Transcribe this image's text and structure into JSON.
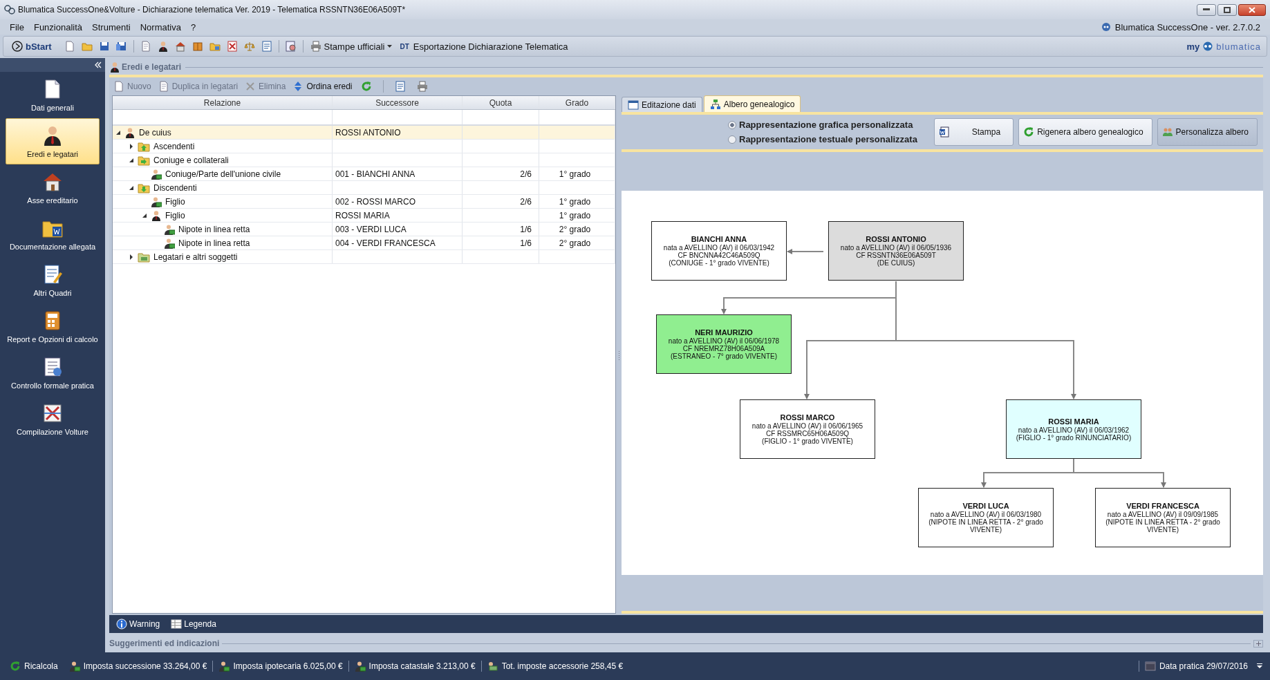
{
  "window": {
    "title": "Blumatica SuccessOne&Volture - Dichiarazione telematica Ver. 2019 - Telematica RSSNTN36E06A509T*",
    "product": "Blumatica SuccessOne - ver. 2.7.0.2"
  },
  "menu": [
    "File",
    "Funzionalità",
    "Strumenti",
    "Normativa",
    "?"
  ],
  "toolbar": {
    "start": "bStart",
    "print": "Stampe ufficiali",
    "export_badge": "DT",
    "export": "Esportazione Dichiarazione Telematica",
    "brand_prefix": "my",
    "brand": "blumatica"
  },
  "sidebar": {
    "items": [
      {
        "label": "Dati generali",
        "selected": false
      },
      {
        "label": "Eredi e legatari",
        "selected": true
      },
      {
        "label": "Asse ereditario",
        "selected": false
      },
      {
        "label": "Documentazione allegata",
        "selected": false
      },
      {
        "label": "Altri Quadri",
        "selected": false
      },
      {
        "label": "Report e Opzioni di calcolo",
        "selected": false
      },
      {
        "label": "Controllo formale pratica",
        "selected": false
      },
      {
        "label": "Compilazione Volture",
        "selected": false
      }
    ]
  },
  "panel": {
    "title": "Eredi e legatari",
    "actions": [
      {
        "label": "Nuovo",
        "disabled": true
      },
      {
        "label": "Duplica in legatari",
        "disabled": true
      },
      {
        "label": "Elimina",
        "disabled": true
      },
      {
        "label": "Ordina eredi",
        "disabled": false
      }
    ]
  },
  "grid": {
    "columns": [
      "Relazione",
      "Successore",
      "Quota",
      "Grado"
    ],
    "rows": [
      {
        "relation": "De cuius",
        "successor": "ROSSI ANTONIO",
        "kind": "person",
        "expanded": true,
        "selected": true,
        "children": [
          {
            "relation": "Ascendenti",
            "kind": "ascendants",
            "expanded": false,
            "selected": false
          },
          {
            "relation": "Coniuge e collaterali",
            "kind": "collaterals",
            "expanded": true,
            "selected": false,
            "children": [
              {
                "relation": "Coniuge/Parte dell'unione civile",
                "successor": "001 - BIANCHI ANNA",
                "share": "2/6",
                "degree": "1° grado",
                "kind": "heir",
                "selected": false
              }
            ]
          },
          {
            "relation": "Discendenti",
            "kind": "descendants",
            "expanded": true,
            "selected": false,
            "children": [
              {
                "relation": "Figlio",
                "successor": "002 - ROSSI MARCO",
                "share": "2/6",
                "degree": "1° grado",
                "kind": "heir",
                "selected": false
              },
              {
                "relation": "Figlio",
                "successor": "ROSSI MARIA",
                "degree": "1° grado",
                "kind": "person",
                "expanded": true,
                "selected": false,
                "children": [
                  {
                    "relation": "Nipote in linea retta",
                    "successor": "003 - VERDI LUCA",
                    "share": "1/6",
                    "degree": "2° grado",
                    "kind": "heir",
                    "selected": false
                  },
                  {
                    "relation": "Nipote in linea retta",
                    "successor": "004 - VERDI FRANCESCA",
                    "share": "1/6",
                    "degree": "2° grado",
                    "kind": "heir",
                    "selected": false
                  }
                ]
              }
            ]
          },
          {
            "relation": "Legatari e altri soggetti",
            "kind": "legatees",
            "expanded": false,
            "selected": false
          }
        ]
      }
    ]
  },
  "tabs": [
    {
      "label": "Editazione dati",
      "selected": false
    },
    {
      "label": "Albero genealogico",
      "selected": true
    }
  ],
  "options": [
    {
      "label": "Rappresentazione grafica personalizzata",
      "selected": true
    },
    {
      "label": "Rappresentazione testuale personalizzata",
      "selected": false
    }
  ],
  "buttons": [
    {
      "label": "Stampa",
      "selected": false
    },
    {
      "label": "Rigenera albero genealogico",
      "selected": false
    },
    {
      "label": "Personalizza albero",
      "selected": true
    }
  ],
  "family_tree": {
    "nodes": [
      {
        "name": "BIANCHI ANNA",
        "lines": [
          "nata a AVELLINO (AV) il 06/03/1942",
          "CF BNCNNA42C46A509Q",
          "(CONIUGE - 1° grado   VIVENTE)"
        ],
        "color": "#ffffff"
      },
      {
        "name": "ROSSI ANTONIO",
        "lines": [
          "nato a AVELLINO (AV) il 06/05/1936",
          "CF RSSNTN36E06A509T",
          "(DE CUIUS)"
        ],
        "color": "#dcdcdc"
      },
      {
        "name": "NERI MAURIZIO",
        "lines": [
          "nato a AVELLINO (AV) il 06/06/1978",
          "CF NREMRZ78H06A509A",
          "(ESTRANEO - 7° grado   VIVENTE)"
        ],
        "color": "#90ee90"
      },
      {
        "name": "ROSSI MARCO",
        "lines": [
          "nato a AVELLINO (AV) il 06/06/1965",
          "CF RSSMRC65H06A509Q",
          "(FIGLIO - 1° grado   VIVENTE)"
        ],
        "color": "#ffffff"
      },
      {
        "name": "ROSSI MARIA",
        "lines": [
          "nato a AVELLINO (AV) il 06/03/1962",
          "(FIGLIO - 1° grado   RINUNCIATARIO)"
        ],
        "color": "#e0ffff"
      },
      {
        "name": "VERDI LUCA",
        "lines": [
          "nato a AVELLINO (AV) il 06/03/1980",
          "(NIPOTE IN LINEA RETTA - 2° grado",
          "VIVENTE)"
        ],
        "color": "#ffffff"
      },
      {
        "name": "VERDI FRANCESCA",
        "lines": [
          "nato a AVELLINO (AV) il 09/09/1985",
          "(NIPOTE IN LINEA RETTA - 2° grado",
          "VIVENTE)"
        ],
        "color": "#ffffff"
      }
    ]
  },
  "bottom_tabs": [
    "Warning",
    "Legenda"
  ],
  "hints": {
    "title": "Suggerimenti ed indicazioni"
  },
  "status_bar": {
    "recalc": "Ricalcola",
    "totals": [
      "Imposta successione 33.264,00 €",
      "Imposta ipotecaria 6.025,00 €",
      "Imposta catastale 3.213,00 €",
      "Tot. imposte accessorie 258,45 €"
    ],
    "date": "Data pratica 29/07/2016"
  }
}
